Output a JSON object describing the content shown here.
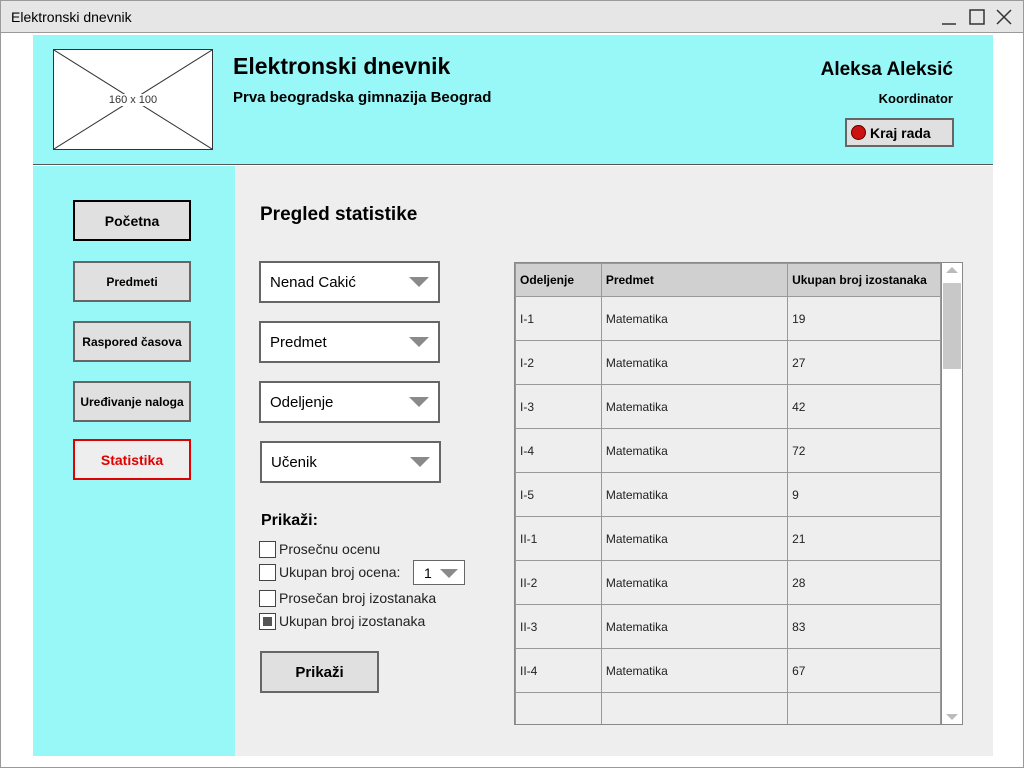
{
  "window": {
    "title": "Elektronski dnevnik"
  },
  "header": {
    "logo_placeholder": "160 x 100",
    "app_title": "Elektronski dnevnik",
    "school": "Prva beogradska gimnazija Beograd",
    "user_name": "Aleksa Aleksić",
    "user_role": "Koordinator",
    "logout_label": "Kraj rada"
  },
  "sidebar": {
    "items": [
      {
        "label": "Početna"
      },
      {
        "label": "Predmeti"
      },
      {
        "label": "Raspored časova"
      },
      {
        "label": "Uređivanje naloga"
      },
      {
        "label": "Statistika"
      }
    ]
  },
  "main": {
    "title": "Pregled statistike",
    "filters": [
      {
        "value": "Nenad Cakić"
      },
      {
        "value": "Predmet"
      },
      {
        "value": "Odeljenje"
      },
      {
        "value": "Učenik"
      }
    ],
    "show_label": "Prikaži:",
    "options": [
      {
        "label": "Prosečnu ocenu",
        "checked": false
      },
      {
        "label": "Ukupan broj ocena:",
        "checked": false
      },
      {
        "label": "Prosečan broj izostanaka",
        "checked": false
      },
      {
        "label": "Ukupan broj izostanaka",
        "checked": true
      }
    ],
    "grades_count_value": "1",
    "submit_label": "Prikaži"
  },
  "table": {
    "headers": [
      "Odeljenje",
      "Predmet",
      "Ukupan broj izostanaka"
    ],
    "rows": [
      [
        "I-1",
        "Matematika",
        "19"
      ],
      [
        "I-2",
        "Matematika",
        "27"
      ],
      [
        "I-3",
        "Matematika",
        "42"
      ],
      [
        "I-4",
        "Matematika",
        "72"
      ],
      [
        "I-5",
        "Matematika",
        "9"
      ],
      [
        "II-1",
        "Matematika",
        "21"
      ],
      [
        "II-2",
        "Matematika",
        "28"
      ],
      [
        "II-3",
        "Matematika",
        "83"
      ],
      [
        "II-4",
        "Matematika",
        "67"
      ],
      [
        "",
        "",
        ""
      ]
    ]
  },
  "colors": {
    "accent_cyan": "#98f8f8",
    "active_nav_red": "#e00000",
    "logout_dot": "#cc1111"
  }
}
